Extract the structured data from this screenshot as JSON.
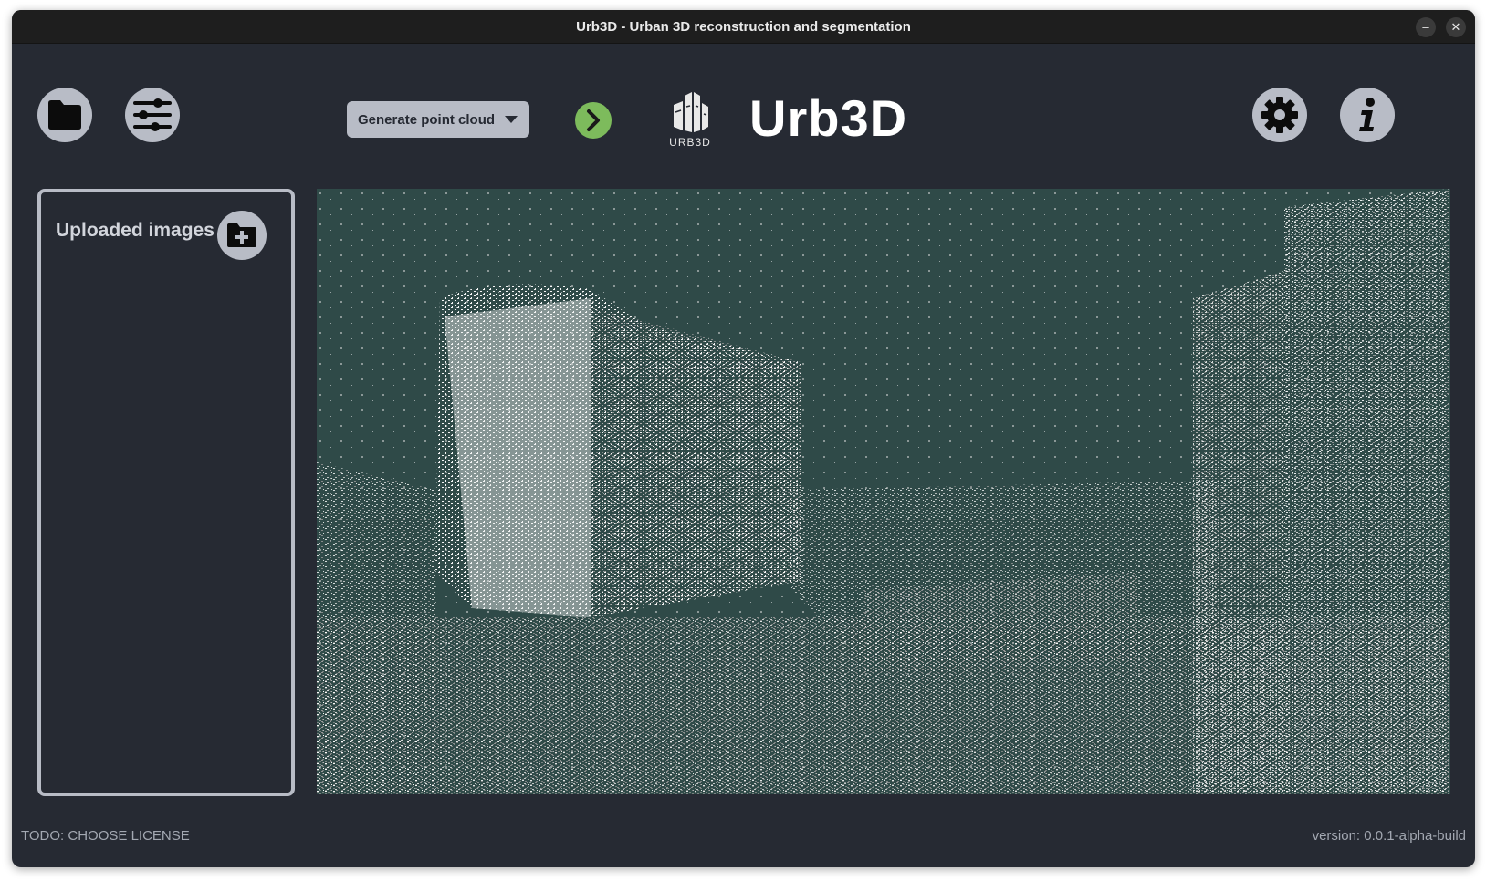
{
  "window": {
    "title": "Urb3D - Urban 3D reconstruction and segmentation",
    "minimize_glyph": "–",
    "close_glyph": "✕"
  },
  "toolbar": {
    "open_icon": "folder-icon",
    "settings_sliders_icon": "sliders-icon",
    "mode_dropdown": {
      "selected": "Generate point cloud"
    },
    "run_icon": "chevron-right-icon",
    "gear_icon": "gear-icon",
    "info_icon": "info-icon",
    "accent_green": "#7dbb5c",
    "button_gray": "#b8bcc6"
  },
  "brand": {
    "logo_text": "URB3D",
    "name": "Urb3D"
  },
  "sidebar": {
    "title": "Uploaded images",
    "add_icon": "folder-plus-icon"
  },
  "viewer": {
    "background": "#2f4a48"
  },
  "footer": {
    "license": "TODO: CHOOSE LICENSE",
    "version": "version: 0.0.1-alpha-build"
  }
}
